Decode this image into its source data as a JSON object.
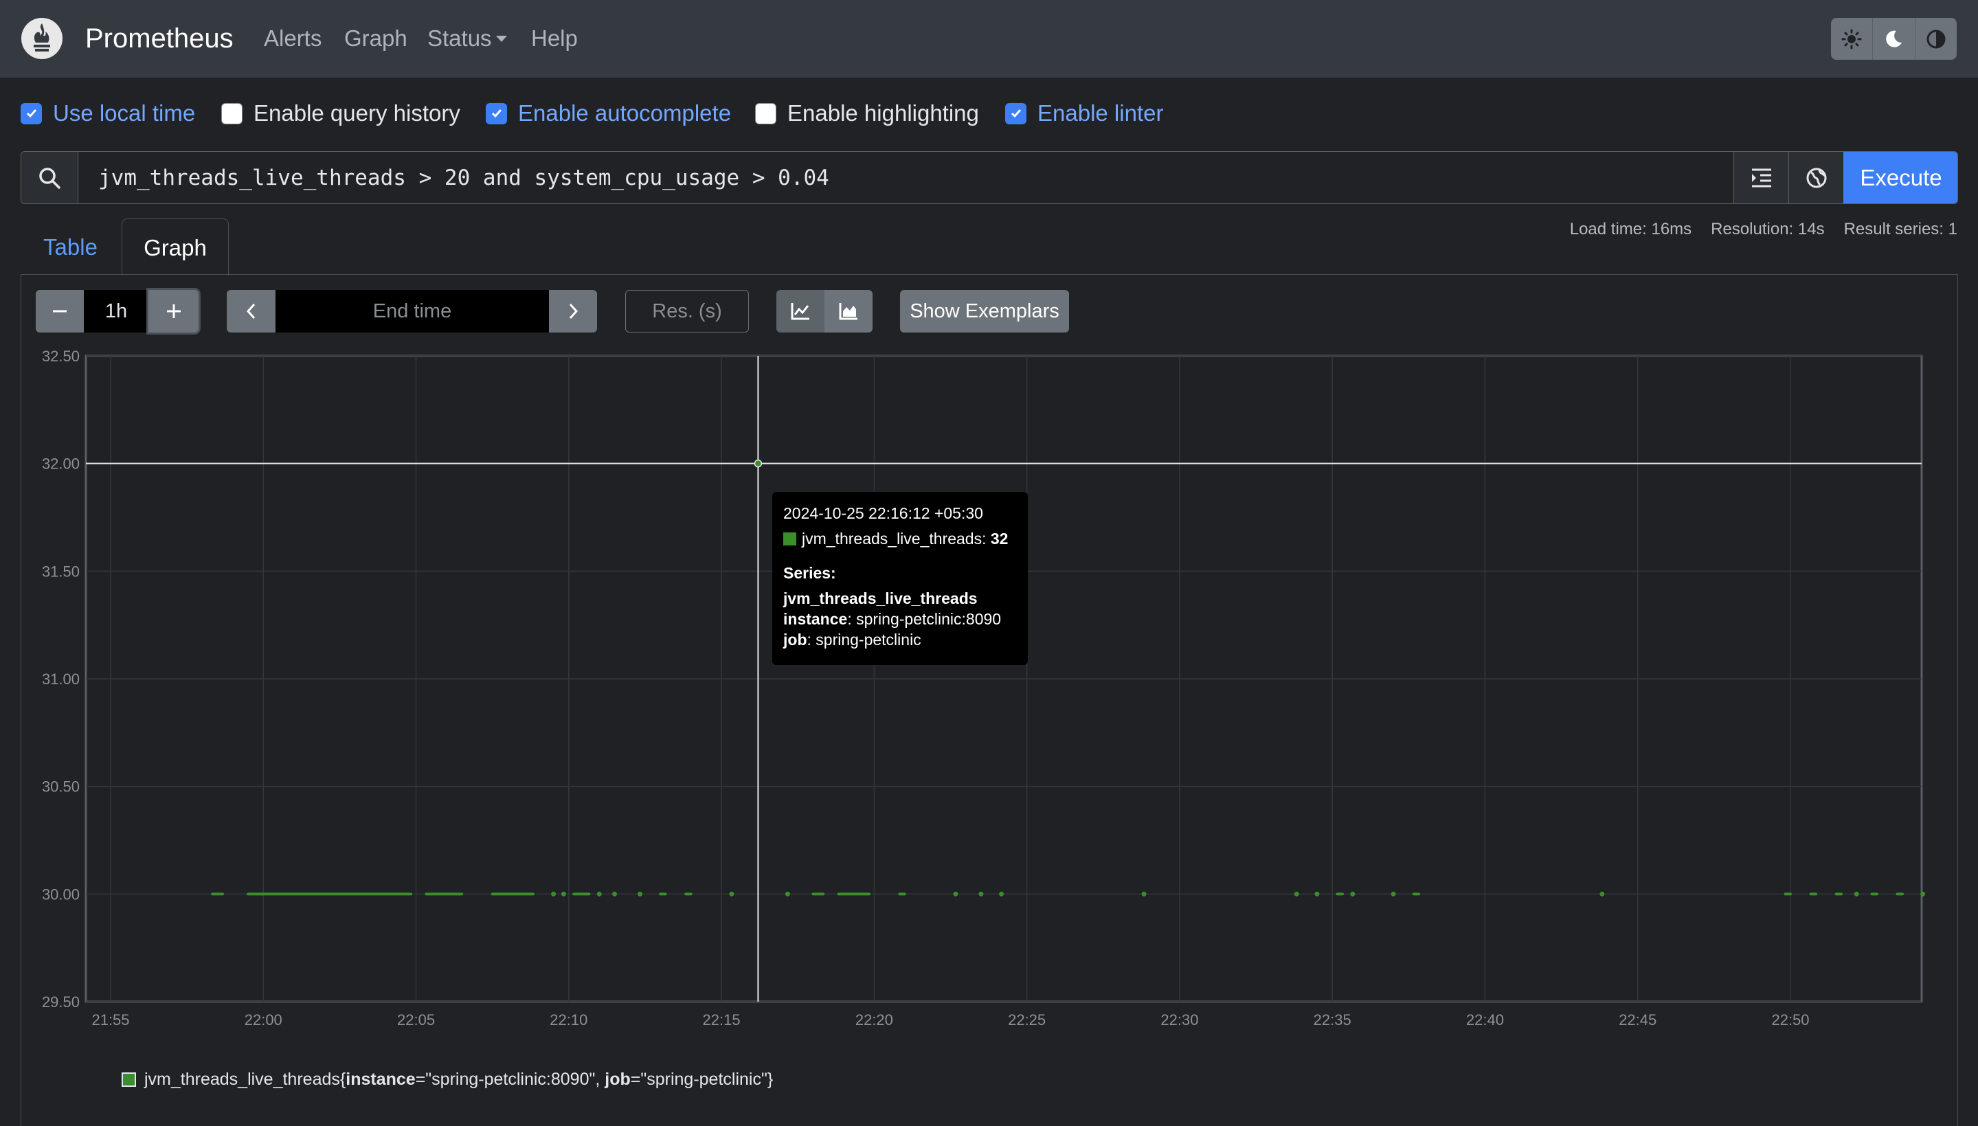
{
  "navbar": {
    "brand": "Prometheus",
    "links": [
      "Alerts",
      "Graph",
      "Status",
      "Help"
    ],
    "theme_icons": [
      "sun-icon",
      "moon-icon",
      "contrast-icon"
    ]
  },
  "options": [
    {
      "label": "Use local time",
      "checked": true
    },
    {
      "label": "Enable query history",
      "checked": false
    },
    {
      "label": "Enable autocomplete",
      "checked": true
    },
    {
      "label": "Enable highlighting",
      "checked": false
    },
    {
      "label": "Enable linter",
      "checked": true
    }
  ],
  "query": {
    "expression": "jvm_threads_live_threads > 20 and system_cpu_usage > 0.04",
    "execute_label": "Execute"
  },
  "tabs": {
    "table": "Table",
    "graph": "Graph"
  },
  "stats": {
    "load_time": "Load time: 16ms",
    "resolution": "Resolution: 14s",
    "result_series": "Result series: 1"
  },
  "controls": {
    "range": "1h",
    "end_time_placeholder": "End time",
    "resolution_placeholder": "Res. (s)",
    "show_exemplars": "Show Exemplars"
  },
  "colors": {
    "accent": "#3d7ff6",
    "series": "#3a8f2a",
    "background": "#202225",
    "navbar": "#343a40"
  },
  "chart_data": {
    "type": "scatter",
    "title": "",
    "xlabel": "",
    "ylabel": "",
    "ylim": [
      29.5,
      32.5
    ],
    "x_ticks": [
      "21:55",
      "22:00",
      "22:05",
      "22:10",
      "22:15",
      "22:20",
      "22:25",
      "22:30",
      "22:35",
      "22:40",
      "22:45",
      "22:50"
    ],
    "y_ticks": [
      "29.50",
      "30.00",
      "30.50",
      "31.00",
      "31.50",
      "32.00",
      "32.50"
    ],
    "series": [
      {
        "name": "jvm_threads_live_threads",
        "runs": [
          [
            "21:58:20",
            "21:58:40",
            30
          ],
          [
            "21:59:30",
            "22:04:50",
            30
          ],
          [
            "22:05:20",
            "22:06:30",
            30
          ],
          [
            "22:07:30",
            "22:08:50",
            30
          ],
          [
            "22:09:30",
            "22:09:30",
            30
          ],
          [
            "22:09:50",
            "22:09:50",
            30
          ],
          [
            "22:10:10",
            "22:10:40",
            30
          ],
          [
            "22:11:00",
            "22:11:00",
            30
          ],
          [
            "22:11:30",
            "22:11:30",
            30
          ],
          [
            "22:12:20",
            "22:12:20",
            30
          ],
          [
            "22:13:00",
            "22:13:10",
            30
          ],
          [
            "22:13:50",
            "22:14:00",
            30
          ],
          [
            "22:15:20",
            "22:15:20",
            30
          ],
          [
            "22:16:12",
            "22:16:12",
            32
          ],
          [
            "22:17:10",
            "22:17:10",
            30
          ],
          [
            "22:18:00",
            "22:18:20",
            30
          ],
          [
            "22:18:50",
            "22:19:50",
            30
          ],
          [
            "22:20:50",
            "22:21:00",
            30
          ],
          [
            "22:22:40",
            "22:22:40",
            30
          ],
          [
            "22:23:30",
            "22:23:30",
            30
          ],
          [
            "22:24:10",
            "22:24:10",
            30
          ],
          [
            "22:28:50",
            "22:28:50",
            30
          ],
          [
            "22:33:50",
            "22:33:50",
            30
          ],
          [
            "22:34:30",
            "22:34:30",
            30
          ],
          [
            "22:35:10",
            "22:35:20",
            30
          ],
          [
            "22:35:40",
            "22:35:40",
            30
          ],
          [
            "22:37:00",
            "22:37:00",
            30
          ],
          [
            "22:37:40",
            "22:37:50",
            30
          ],
          [
            "22:43:50",
            "22:43:50",
            30
          ],
          [
            "22:49:50",
            "22:50:00",
            30
          ],
          [
            "22:50:40",
            "22:50:50",
            30
          ],
          [
            "22:51:30",
            "22:51:40",
            30
          ],
          [
            "22:52:10",
            "22:52:10",
            30
          ],
          [
            "22:52:40",
            "22:52:50",
            30
          ],
          [
            "22:53:30",
            "22:53:40",
            30
          ],
          [
            "22:54:20",
            "22:54:20",
            30
          ]
        ]
      }
    ],
    "legend": {
      "metric": "jvm_threads_live_threads",
      "labels": [
        {
          "key": "instance",
          "value": "\"spring-petclinic:8090\""
        },
        {
          "key": "job",
          "value": "\"spring-petclinic\""
        }
      ]
    },
    "hover": {
      "time": "22:16:12",
      "value": 32
    }
  },
  "tooltip": {
    "timestamp": "2024-10-25 22:16:12 +05:30",
    "series_name": "jvm_threads_live_threads",
    "value": "32",
    "series_heading": "Series:",
    "metric": "jvm_threads_live_threads",
    "instance_key": "instance",
    "instance_value": "spring-petclinic:8090",
    "job_key": "job",
    "job_value": "spring-petclinic"
  }
}
